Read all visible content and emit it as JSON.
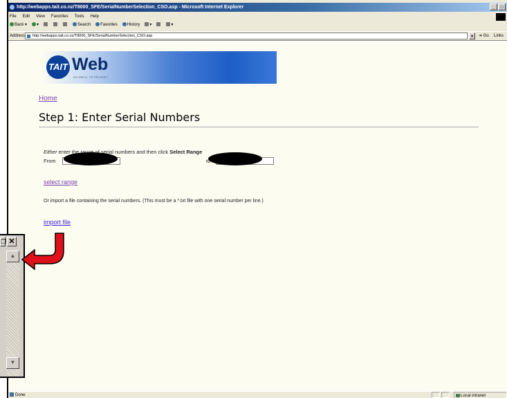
{
  "browser": {
    "title": "http://webapps.tait.co.nz/T8000_SFE/SerialNumberSelection_CSO.asp - Microsoft Internet Explorer",
    "menu": [
      "File",
      "Edit",
      "View",
      "Favorites",
      "Tools",
      "Help"
    ],
    "toolbar": {
      "back": "Back",
      "search": "Search",
      "favorites": "Favorites",
      "history": "History"
    },
    "address_label": "Address",
    "address_value": "http://webapps.tait.co.nz/T8000_SFE/SerialNumberSelection_CSO.asp",
    "go": "Go",
    "links": "Links",
    "status_left": "Done",
    "status_zone": "Local intranet"
  },
  "banner": {
    "logo_text": "TAIT",
    "title": "Web",
    "subtitle": "GLOBAL INTRANET"
  },
  "page": {
    "home_link": "Home",
    "title": "Step 1: Enter Serial Numbers",
    "instruction_prefix": "Either",
    "instruction_middle": " enter the range of serial numbers and then click ",
    "instruction_bold": "Select Range",
    "from_label": "From",
    "to_label": "to",
    "select_range_link": "select range",
    "import_text": "Or import a file containing the serial numbers. (This must be a *.txt file with one serial number per line.)",
    "import_link": "import file"
  },
  "snippet": {
    "restore_glyph": "❐",
    "close_glyph": "✕",
    "up_glyph": "▲",
    "down_glyph": "▼"
  },
  "colors": {
    "visited_link": "#7b3fae",
    "unvisited_link": "#3a1fd8",
    "arrow": "#e0101a"
  }
}
